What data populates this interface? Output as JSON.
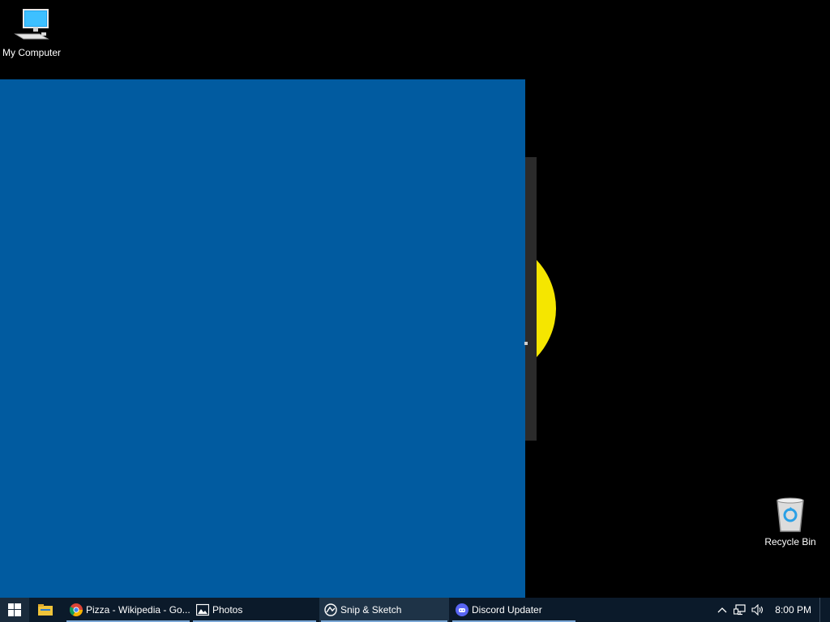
{
  "desktop": {
    "icons": [
      {
        "label": "My Computer",
        "icon": "computer-icon"
      },
      {
        "label": "Recycle Bin",
        "icon": "recycle-bin-icon"
      }
    ]
  },
  "taskbar": {
    "start_icon": "windows-logo-icon",
    "pinned": [
      {
        "icon": "file-explorer-icon"
      }
    ],
    "tasks": [
      {
        "label": "Pizza - Wikipedia - Go...",
        "icon": "chrome-icon"
      },
      {
        "label": "Photos",
        "icon": "photos-icon"
      },
      {
        "label": "Snip & Sketch",
        "icon": "snip-sketch-icon"
      },
      {
        "label": "Discord Updater",
        "icon": "discord-icon"
      }
    ],
    "tray": {
      "icons": [
        "chevron-up-icon",
        "network-icon",
        "volume-icon"
      ],
      "clock": "8:00 PM"
    }
  },
  "colors": {
    "window_blue": "#015ba0",
    "taskbar": "#0b1a2a",
    "yellow": "#f5e600"
  }
}
